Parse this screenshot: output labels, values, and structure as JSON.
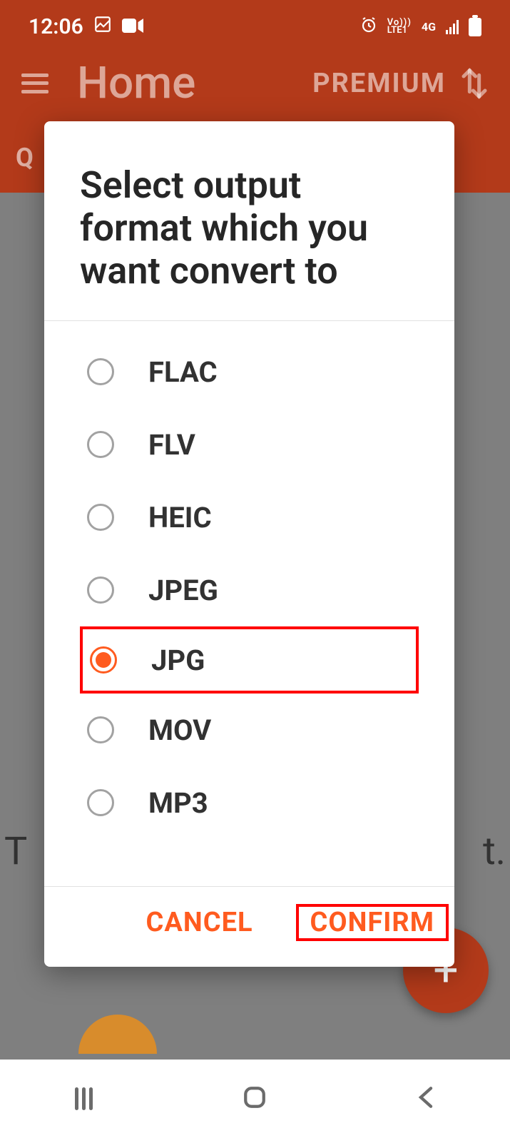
{
  "status": {
    "time": "12:06",
    "volte_top": "Vo)))",
    "volte_bot": "LTE1",
    "network": "4G"
  },
  "toolbar": {
    "title": "Home",
    "premium": "PREMIUM",
    "tab_fragment": "Q"
  },
  "background": {
    "left_char": "T",
    "right_char": "t."
  },
  "dialog": {
    "title": "Select output format which you want convert to",
    "options": [
      {
        "label": "FLAC",
        "selected": false
      },
      {
        "label": "FLV",
        "selected": false
      },
      {
        "label": "HEIC",
        "selected": false
      },
      {
        "label": "JPEG",
        "selected": false
      },
      {
        "label": "JPG",
        "selected": true,
        "highlight": true
      },
      {
        "label": "MOV",
        "selected": false
      },
      {
        "label": "MP3",
        "selected": false
      }
    ],
    "cancel": "CANCEL",
    "confirm": "CONFIRM"
  }
}
